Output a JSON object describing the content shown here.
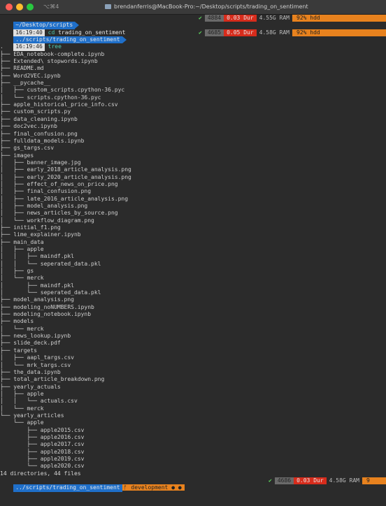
{
  "window": {
    "shortcut": "⌥⌘4",
    "title": "brendanferris@MacBook-Pro:~/Desktop/scripts/trading_on_sentiment"
  },
  "prompts": [
    {
      "dir": "~/Desktop/scripts",
      "time": "16:19:40",
      "cmd": "cd",
      "arg": "trading_on_sentiment",
      "status": {
        "check": "✔",
        "count": "4884",
        "dur": "0.03 Dur",
        "ram": "4.55G RAM",
        "hdd": "92% hdd"
      }
    },
    {
      "dir": "../scripts/trading_on_sentiment",
      "time": "16:19:46",
      "cmd": "tree",
      "arg": "",
      "status": {
        "check": "✔",
        "count": "4685",
        "dur": "0.05 Dur",
        "ram": "4.58G RAM",
        "hdd": "92% hdd"
      }
    }
  ],
  "tree": [
    ".",
    "├── EDA_notebook-complete.ipynb",
    "├── Extended\\ stopwords.ipynb",
    "├── README.md",
    "├── Word2VEC.ipynb",
    "├── __pycache__",
    "│   ├── custom_scripts.cpython-36.pyc",
    "│   └── scripts.cpython-36.pyc",
    "├── apple_historical_price_info.csv",
    "├── custom_scripts.py",
    "├── data_cleaning.ipynb",
    "├── doc2vec.ipynb",
    "├── final_confusion.png",
    "├── fulldata_models.ipynb",
    "├── gs_targs.csv",
    "├── images",
    "│   ├── banner_image.jpg",
    "│   ├── early_2018_article_analysis.png",
    "│   ├── early_2020_article_analysis.png",
    "│   ├── effect_of_news_on_price.png",
    "│   ├── final_confusion.png",
    "│   ├── late_2016_article_analysis.png",
    "│   ├── model_analysis.png",
    "│   ├── news_articles_by_source.png",
    "│   └── workflow_diagram.png",
    "├── initial_f1.png",
    "├── lime_explainer.ipynb",
    "├── main_data",
    "│   ├── apple",
    "│   │   ├── maindf.pkl",
    "│   │   └── seperated_data.pkl",
    "│   ├── gs",
    "│   └── merck",
    "│       ├── maindf.pkl",
    "│       └── seperated_data.pkl",
    "├── model_analysis.png",
    "├── modeling_noNUMBERS.ipynb",
    "├── modeling_notebook.ipynb",
    "├── models",
    "│   └── merck",
    "├── news_lookup.ipynb",
    "├── slide_deck.pdf",
    "├── targets",
    "│   ├── aapl_targs.csv",
    "│   └── mrk_targs.csv",
    "├── the_data.ipynb",
    "├── total_article_breakdown.png",
    "├── yearly_actuals",
    "│   ├── apple",
    "│   │   └── actuals.csv",
    "│   └── merck",
    "└── yearly_articles",
    "    └── apple",
    "        ├── apple2015.csv",
    "        ├── apple2016.csv",
    "        ├── apple2017.csv",
    "        ├── apple2018.csv",
    "        ├── apple2019.csv",
    "        └── apple2020.csv"
  ],
  "summary": "14 directories, 44 files",
  "final_prompt": {
    "dir": "../scripts/trading_on_sentiment",
    "branch": "development ● ●",
    "status": {
      "check": "✔",
      "count": "4686",
      "dur": "0.03 Dur",
      "ram": "4.58G RAM",
      "hdd": "9"
    }
  },
  "colors": {
    "dir_segment": "#1f6fc9",
    "dur_segment": "#d72c1c",
    "hdd_segment": "#e8821e",
    "background": "#2b2b2b"
  }
}
